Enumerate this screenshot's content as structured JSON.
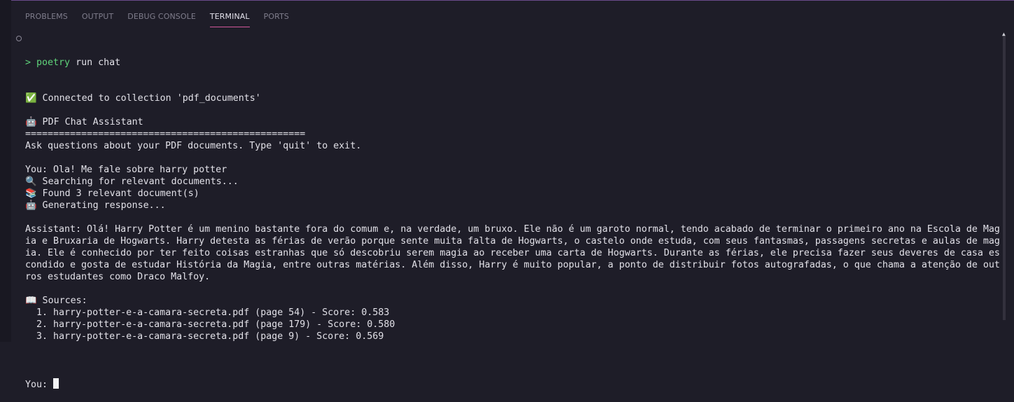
{
  "tabs": [
    {
      "label": "PROBLEMS"
    },
    {
      "label": "OUTPUT"
    },
    {
      "label": "DEBUG CONSOLE"
    },
    {
      "label": "TERMINAL",
      "active": true
    },
    {
      "label": "PORTS"
    }
  ],
  "terminal": {
    "prompt_symbol": ">",
    "command": "poetry run chat",
    "lines": [
      "✅ Connected to collection 'pdf_documents'",
      "",
      "🤖 PDF Chat Assistant",
      "==================================================",
      "Ask questions about your PDF documents. Type 'quit' to exit.",
      "",
      "You: Ola! Me fale sobre harry potter",
      "🔍 Searching for relevant documents...",
      "📚 Found 3 relevant document(s)",
      "🤖 Generating response...",
      "",
      "Assistant: Olá! Harry Potter é um menino bastante fora do comum e, na verdade, um bruxo. Ele não é um garoto normal, tendo acabado de terminar o primeiro ano na Escola de Mag",
      "ia e Bruxaria de Hogwarts. Harry detesta as férias de verão porque sente muita falta de Hogwarts, o castelo onde estuda, com seus fantasmas, passagens secretas e aulas de mag",
      "ia. Ele é conhecido por ter feito coisas estranhas que só descobriu serem magia ao receber uma carta de Hogwarts. Durante as férias, ele precisa fazer seus deveres de casa es",
      "condido e gosta de estudar História da Magia, entre outras matérias. Além disso, Harry é muito popular, a ponto de distribuir fotos autografadas, o que chama a atenção de out",
      "ros estudantes como Draco Malfoy.",
      "",
      "📖 Sources:",
      "  1. harry-potter-e-a-camara-secreta.pdf (page 54) - Score: 0.583",
      "  2. harry-potter-e-a-camara-secreta.pdf (page 179) - Score: 0.580",
      "  3. harry-potter-e-a-camara-secreta.pdf (page 9) - Score: 0.569",
      ""
    ],
    "input_prompt": "You: "
  },
  "colors": {
    "background": "#1e1d28",
    "prompt": "#5fd37a",
    "active_tab_underline": "#d2579b",
    "text": "#e2e1e8"
  }
}
